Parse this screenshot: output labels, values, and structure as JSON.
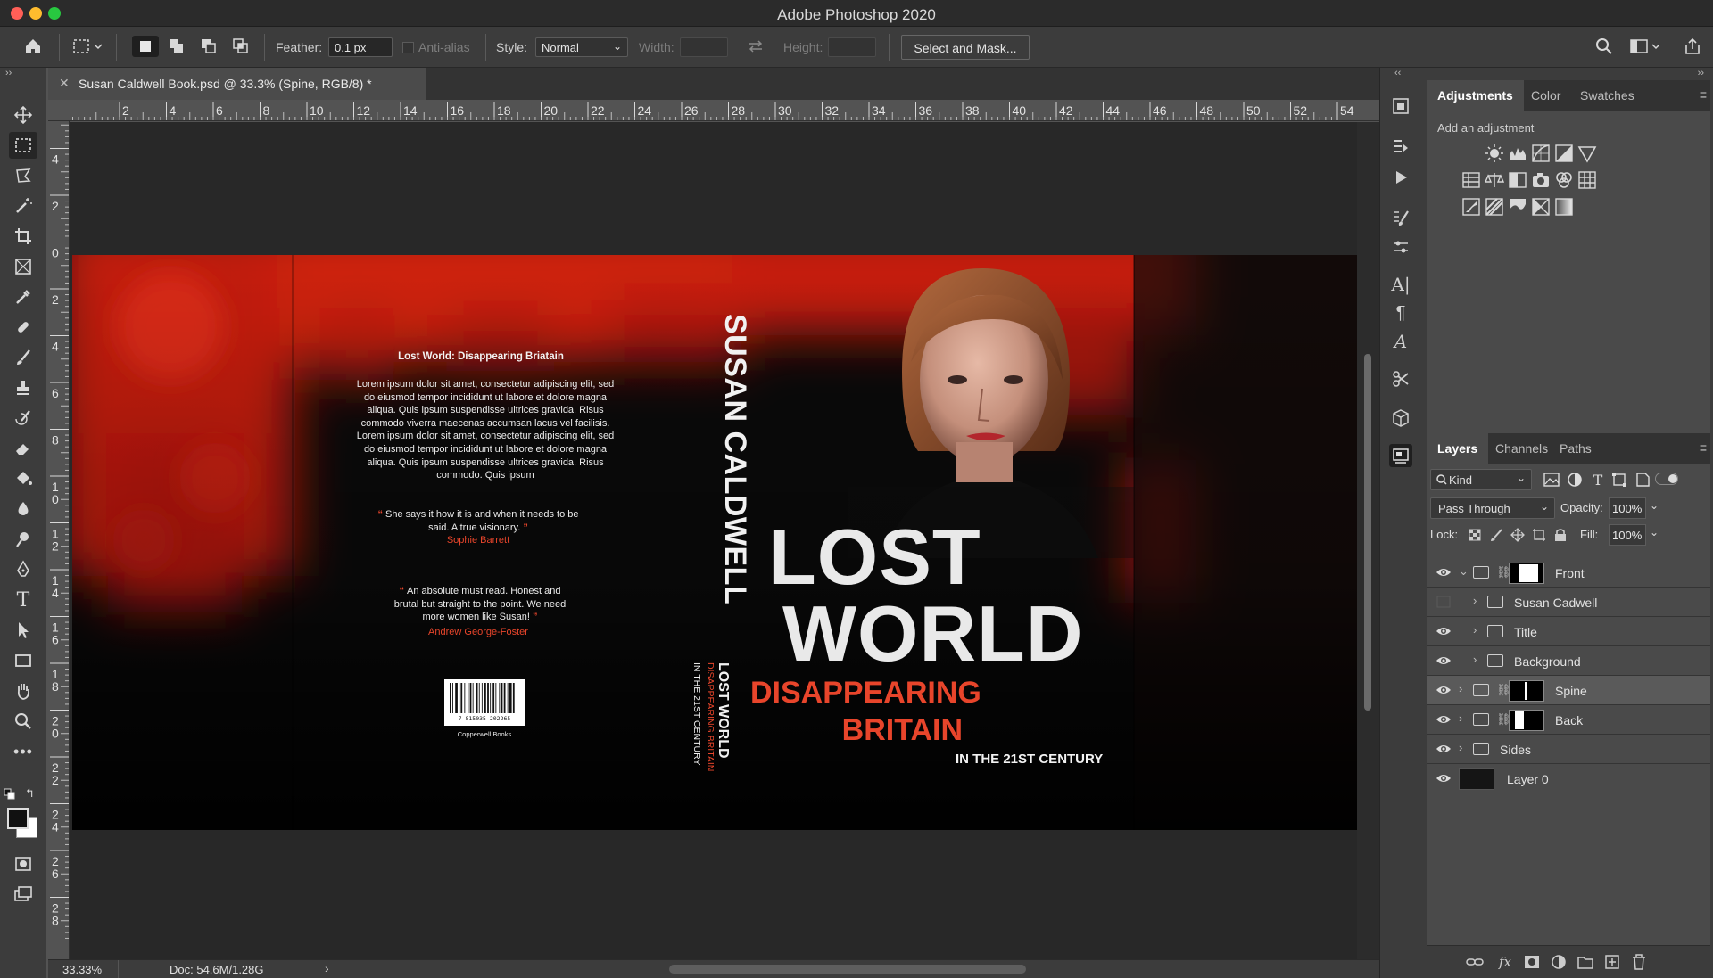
{
  "app": {
    "window_title": "Adobe Photoshop 2020"
  },
  "options_bar": {
    "feather_label": "Feather:",
    "feather_value": "0.1 px",
    "antialias_label": "Anti-alias",
    "style_label": "Style:",
    "style_value": "Normal",
    "width_label": "Width:",
    "height_label": "Height:",
    "select_mask_label": "Select and Mask..."
  },
  "document": {
    "tab_title": "Susan Caldwell Book.psd @ 33.3% (Spine, RGB/8) *",
    "close_glyph": "✕",
    "zoom": "33.33%",
    "doc_size": "Doc: 54.6M/1.28G"
  },
  "rulers": {
    "horizontal": [
      "2",
      "4",
      "6",
      "8",
      "10",
      "12",
      "14",
      "16",
      "18",
      "20",
      "22",
      "24",
      "26",
      "28",
      "30",
      "32",
      "34",
      "36",
      "38",
      "40",
      "42",
      "44",
      "46",
      "48",
      "50",
      "52",
      "54"
    ],
    "vertical": [
      "6",
      "4",
      "2",
      "0",
      "2",
      "4",
      "6",
      "8",
      "10",
      "12",
      "14",
      "16",
      "18",
      "20",
      "22",
      "24",
      "26",
      "28"
    ]
  },
  "cover": {
    "back_heading": "Lost World: Disappearing Briatain",
    "back_body": "Lorem ipsum dolor sit amet, consectetur adipiscing elit, sed do eiusmod tempor incididunt ut labore et dolore magna aliqua. Quis ipsum suspendisse ultrices gravida. Risus commodo viverra maecenas accumsan lacus vel facilisis.  Lorem ipsum dolor sit amet, consectetur adipiscing elit, sed do eiusmod tempor incididunt ut labore et dolore magna aliqua. Quis ipsum suspendisse ultrices gravida. Risus commodo.  Quis ipsum",
    "quote1": "She says it how it is and when it needs to be said. A true visionary.",
    "quote1_author": "Sophie Barrett",
    "quote2": "An absolute must read. Honest and brutal but straight to the point. We need more women like Susan!",
    "quote2_author": "Andrew George-Foster",
    "barcode_number": "7 815035 202265",
    "publisher": "Copperwell Books",
    "spine_author": "SUSAN CALDWELL",
    "spine_title": "LOST WORLD",
    "spine_subtitle": "DISAPPEARING BRITAIN",
    "spine_tagline": "IN THE 21ST CENTURY",
    "front_title_line1": "LOST",
    "front_title_line2": "WORLD",
    "front_sub_line1": "DISAPPEARING",
    "front_sub_line2": "BRITAIN",
    "front_tagline": "IN THE 21ST CENTURY",
    "accent_color": "#e8452b"
  },
  "adjustments_panel": {
    "tabs": [
      "Adjustments",
      "Color",
      "Swatches"
    ],
    "hint": "Add an adjustment"
  },
  "layers_panel": {
    "tabs": [
      "Layers",
      "Channels",
      "Paths"
    ],
    "kind_label": "Kind",
    "blend_mode": "Pass Through",
    "opacity_label": "Opacity:",
    "opacity_value": "100%",
    "lock_label": "Lock:",
    "fill_label": "Fill:",
    "fill_value": "100%",
    "layers": [
      {
        "name": "Front",
        "visible": true,
        "expanded": true,
        "has_mask": true,
        "selected": false
      },
      {
        "name": "Susan Cadwell",
        "visible": false,
        "child": true,
        "has_mask": false,
        "selected": false
      },
      {
        "name": "Title",
        "visible": true,
        "child": true,
        "has_mask": false,
        "selected": false
      },
      {
        "name": "Background",
        "visible": true,
        "child": true,
        "has_mask": false,
        "selected": false
      },
      {
        "name": "Spine",
        "visible": true,
        "has_mask": true,
        "selected": true
      },
      {
        "name": "Back",
        "visible": true,
        "has_mask": true,
        "selected": false
      },
      {
        "name": "Sides",
        "visible": true,
        "has_mask": false,
        "selected": false
      },
      {
        "name": "Layer 0",
        "visible": true,
        "has_mask": false,
        "selected": false
      }
    ]
  },
  "colors": {
    "titlebar": "#2b2b2b",
    "panel": "#3c3c3c",
    "canvas": "#282828",
    "selected_layer": "#5a5a5a",
    "traffic_close": "#ff5f57",
    "traffic_min": "#febc2e",
    "traffic_max": "#28c840"
  }
}
